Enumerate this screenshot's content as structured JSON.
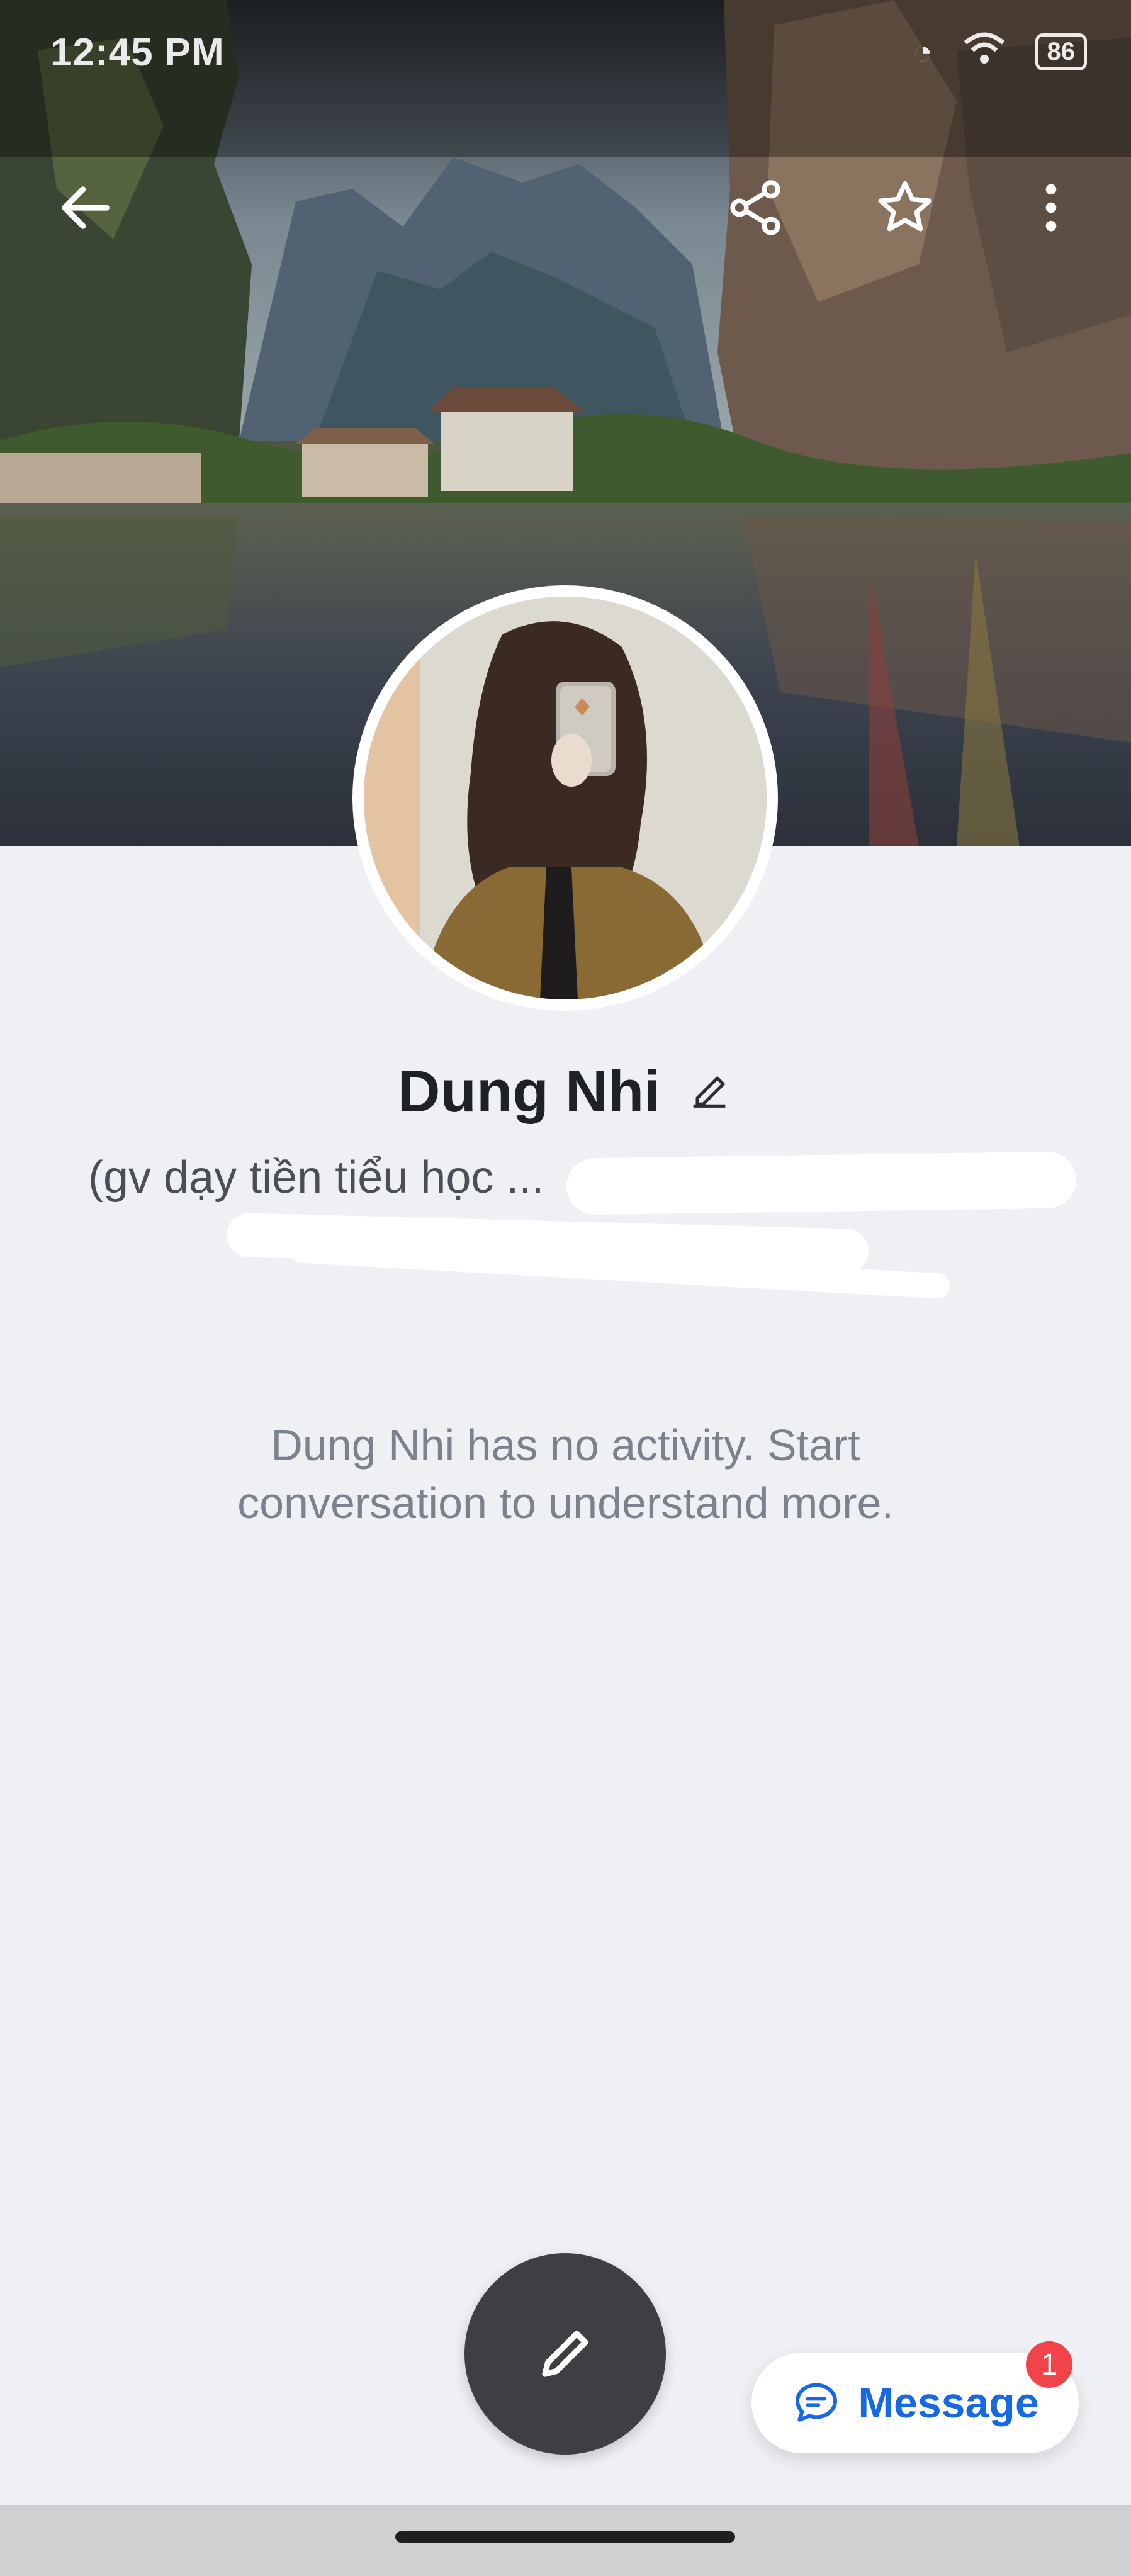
{
  "status_bar": {
    "time": "12:45 PM",
    "battery": "86"
  },
  "profile": {
    "name": "Dung Nhi",
    "bio_visible": "(gv dạy tiền tiểu học ...",
    "activity_message": "Dung Nhi has no activity. Start conversation to understand more."
  },
  "actions": {
    "message_label": "Message",
    "message_badge": "1"
  },
  "icons": {
    "back": "arrow-left-icon",
    "share": "share-icon",
    "favorite": "star-icon",
    "more": "more-vertical-icon",
    "edit_name": "pencil-icon",
    "compose": "pencil-icon",
    "message": "chat-bubble-icon"
  },
  "colors": {
    "page_background": "#eef0f4",
    "accent": "#1668e3",
    "badge": "#f2424a",
    "fab": "#3d3f42"
  }
}
